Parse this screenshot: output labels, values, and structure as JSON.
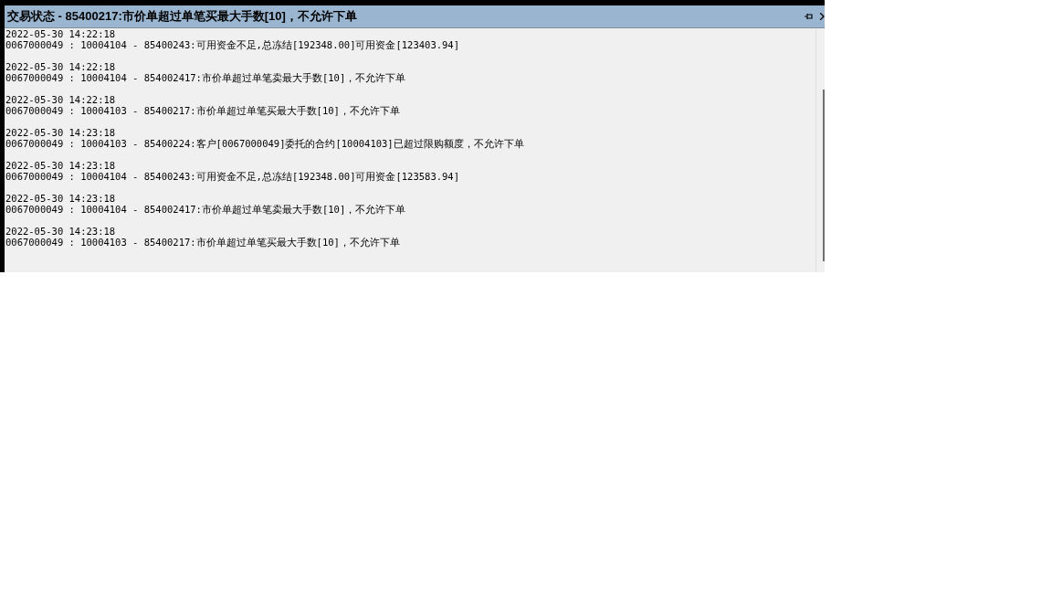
{
  "panel": {
    "title": "交易状态 - 85400217:市价单超过单笔买最大手数[10]，不允许下单"
  },
  "log": [
    {
      "time": "2022-05-30 14:22:18",
      "message": "0067000049 : 10004104 - 85400243:可用资金不足,总冻结[192348.00]可用资金[123403.94]"
    },
    {
      "time": "2022-05-30 14:22:18",
      "message": "0067000049 : 10004104 - 854002417:市价单超过单笔卖最大手数[10]，不允许下单"
    },
    {
      "time": "2022-05-30 14:22:18",
      "message": "0067000049 : 10004103 - 85400217:市价单超过单笔买最大手数[10]，不允许下单"
    },
    {
      "time": "2022-05-30 14:23:18",
      "message": "0067000049 : 10004103 - 85400224:客户[0067000049]委托的合约[10004103]已超过限购额度，不允许下单"
    },
    {
      "time": "2022-05-30 14:23:18",
      "message": "0067000049 : 10004104 - 85400243:可用资金不足,总冻结[192348.00]可用资金[123583.94]"
    },
    {
      "time": "2022-05-30 14:23:18",
      "message": "0067000049 : 10004104 - 854002417:市价单超过单笔卖最大手数[10]，不允许下单"
    },
    {
      "time": "2022-05-30 14:23:18",
      "message": "0067000049 : 10004103 - 85400217:市价单超过单笔买最大手数[10]，不允许下单"
    }
  ]
}
